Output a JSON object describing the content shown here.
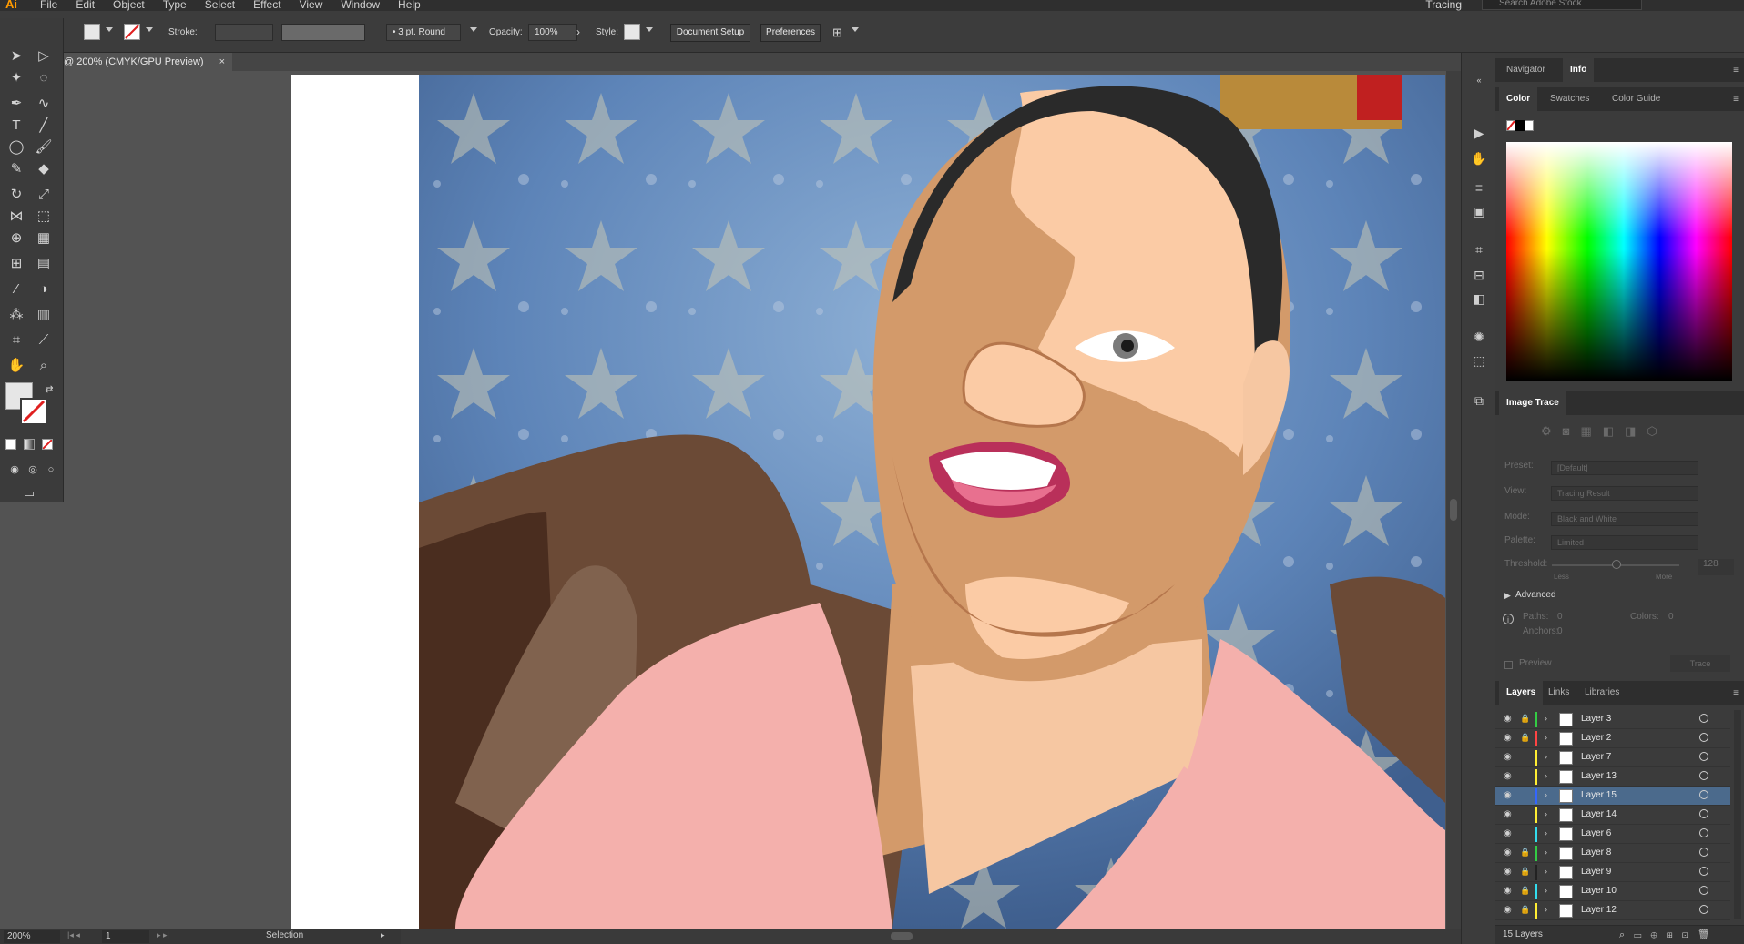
{
  "app": {
    "logo": "Ai",
    "menus": [
      "File",
      "Edit",
      "Object",
      "Type",
      "Select",
      "Effect",
      "View",
      "Window",
      "Help"
    ],
    "workspace": "Tracing",
    "stock_placeholder": "Search Adobe Stock"
  },
  "control": {
    "stroke_label": "Stroke:",
    "brush": "3 pt. Round",
    "opacity_label": "Opacity:",
    "opacity_value": "100%",
    "style_label": "Style:",
    "document_setup": "Document Setup",
    "preferences": "Preferences"
  },
  "document": {
    "tab_title": "@ 200% (CMYK/GPU Preview)",
    "close": "×"
  },
  "status": {
    "zoom": "200%",
    "artboard": "1",
    "tool": "Selection"
  },
  "panels": {
    "top_tabs": [
      "Navigator",
      "Info"
    ],
    "color_tabs": [
      "Color",
      "Swatches",
      "Color Guide"
    ],
    "image_trace": {
      "title": "Image Trace",
      "preset_label": "Preset:",
      "preset_value": "[Default]",
      "view_label": "View:",
      "view_value": "Tracing Result",
      "mode_label": "Mode:",
      "mode_value": "Black and White",
      "palette_label": "Palette:",
      "palette_value": "Limited",
      "threshold_label": "Threshold:",
      "threshold_value": "128",
      "less": "Less",
      "more": "More",
      "advanced": "Advanced",
      "paths_label": "Paths:",
      "paths_value": "0",
      "colors_label": "Colors:",
      "colors_value": "0",
      "anchors_label": "Anchors:",
      "anchors_value": "0",
      "preview": "Preview",
      "trace": "Trace"
    },
    "layers_tabs": [
      "Layers",
      "Links",
      "Libraries"
    ],
    "layers": [
      {
        "name": "Layer 3",
        "color": "#33cc44",
        "locked": true
      },
      {
        "name": "Layer 2",
        "color": "#ff4444",
        "locked": true
      },
      {
        "name": "Layer 7",
        "color": "#ffee33",
        "locked": false
      },
      {
        "name": "Layer 13",
        "color": "#ffee33",
        "locked": false
      },
      {
        "name": "Layer 15",
        "color": "#3366ff",
        "locked": false,
        "selected": true
      },
      {
        "name": "Layer 14",
        "color": "#ffee33",
        "locked": false
      },
      {
        "name": "Layer 6",
        "color": "#33ddee",
        "locked": false
      },
      {
        "name": "Layer 8",
        "color": "#33cc44",
        "locked": true
      },
      {
        "name": "Layer 9",
        "color": "#222222",
        "locked": true
      },
      {
        "name": "Layer 10",
        "color": "#33ddee",
        "locked": true
      },
      {
        "name": "Layer 12",
        "color": "#ffee33",
        "locked": true
      }
    ],
    "layers_count": "15 Layers"
  }
}
